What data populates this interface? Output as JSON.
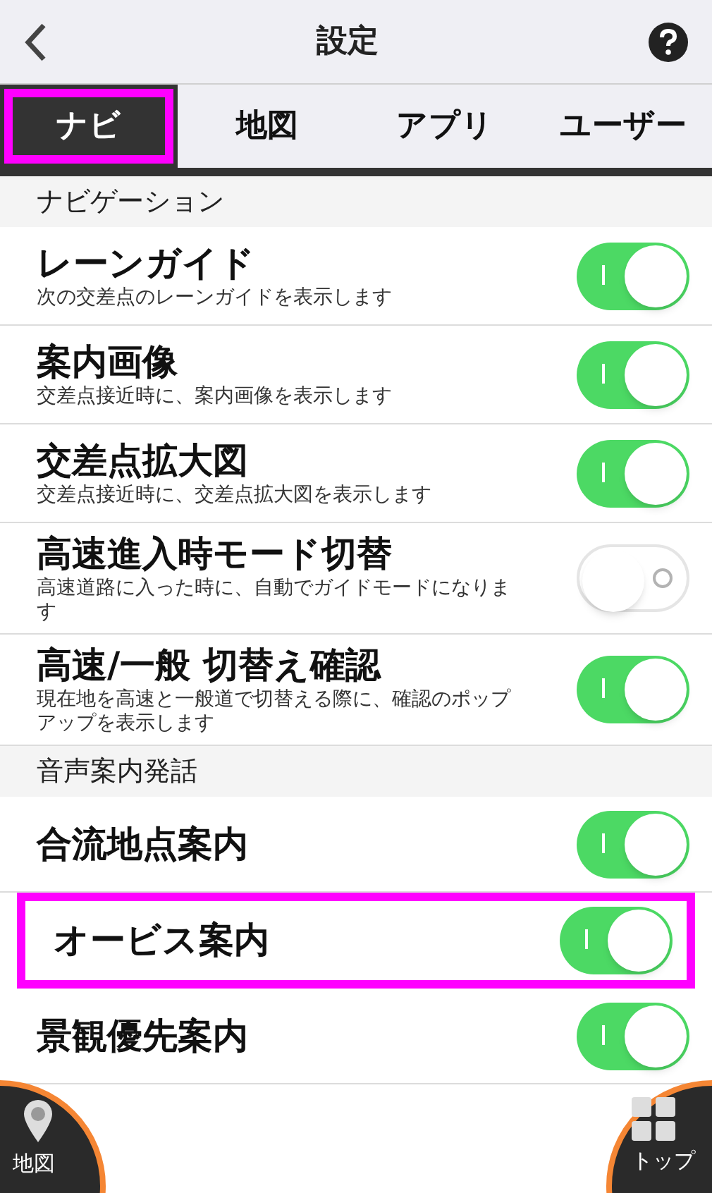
{
  "header": {
    "title": "設定"
  },
  "tabs": [
    {
      "label": "ナビ",
      "selected": true,
      "highlighted": true
    },
    {
      "label": "地図",
      "selected": false,
      "highlighted": false
    },
    {
      "label": "アプリ",
      "selected": false,
      "highlighted": false
    },
    {
      "label": "ユーザー",
      "selected": false,
      "highlighted": false
    }
  ],
  "sections": [
    {
      "title": "ナビゲーション",
      "rows": [
        {
          "label": "レーンガイド",
          "description": "次の交差点のレーンガイドを表示します",
          "on": true,
          "highlighted": false
        },
        {
          "label": "案内画像",
          "description": "交差点接近時に、案内画像を表示します",
          "on": true,
          "highlighted": false
        },
        {
          "label": "交差点拡大図",
          "description": "交差点接近時に、交差点拡大図を表示します",
          "on": true,
          "highlighted": false
        },
        {
          "label": "高速進入時モード切替",
          "description": "高速道路に入った時に、自動でガイドモードになります",
          "on": false,
          "highlighted": false
        },
        {
          "label": "高速/一般 切替え確認",
          "description": "現在地を高速と一般道で切替える際に、確認のポップアップを表示します",
          "on": true,
          "highlighted": false
        }
      ]
    },
    {
      "title": "音声案内発話",
      "rows": [
        {
          "label": "合流地点案内",
          "on": true,
          "highlighted": false
        },
        {
          "label": "オービス案内",
          "on": true,
          "highlighted": true
        },
        {
          "label": "景観優先案内",
          "on": true,
          "highlighted": false
        }
      ]
    }
  ],
  "corner_buttons": [
    {
      "label": "地図",
      "kind": "map"
    },
    {
      "label": "トップ",
      "kind": "top"
    }
  ]
}
